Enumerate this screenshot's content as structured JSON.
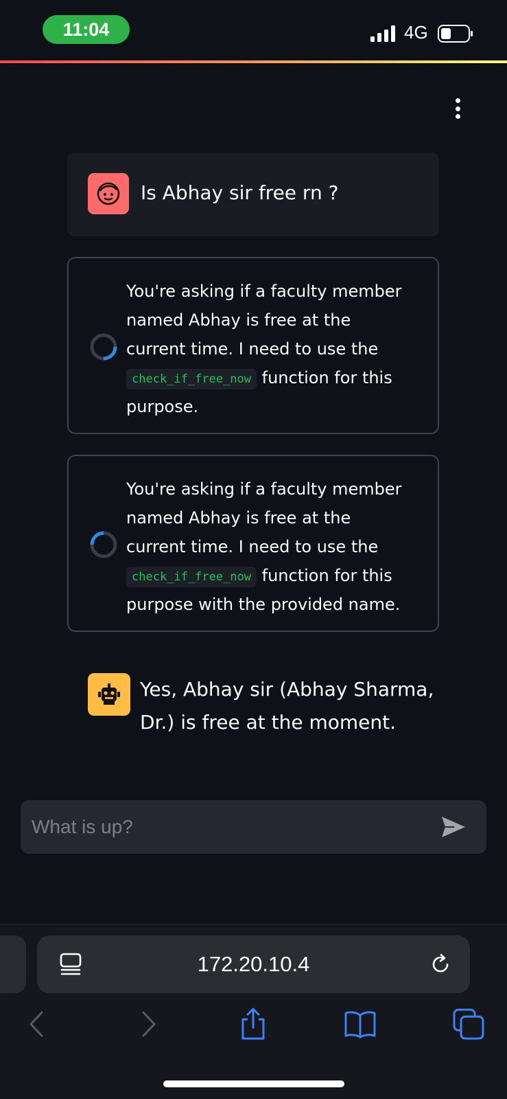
{
  "status_bar": {
    "time": "11:04",
    "network": "4G"
  },
  "messages": {
    "user": {
      "text": "Is Abhay sir free rn ?",
      "avatar_icon": "face-icon",
      "avatar_color": "#ff6b6b"
    },
    "thinking": [
      {
        "before": "You're asking if a faculty member named Abhay is free at the current time. I need to use the",
        "code": "check_if_free_now",
        "after": "function for this purpose."
      },
      {
        "before": "You're asking if a faculty member named Abhay is free at the current time. I need to use the",
        "code": "check_if_free_now",
        "after": "function for this purpose with the provided name."
      }
    ],
    "assistant": {
      "text": "Yes, Abhay sir (Abhay Sharma, Dr.) is free at the moment.",
      "avatar_icon": "robot-icon",
      "avatar_color": "#ffbd45"
    }
  },
  "chat_input": {
    "placeholder": "What is up?"
  },
  "browser": {
    "url": "172.20.10.4"
  },
  "colors": {
    "accent_gradient_start": "#ff4b4b",
    "accent_gradient_end": "#fffd80",
    "code_text": "#21c354",
    "toolbar_active": "#3b82f6"
  }
}
